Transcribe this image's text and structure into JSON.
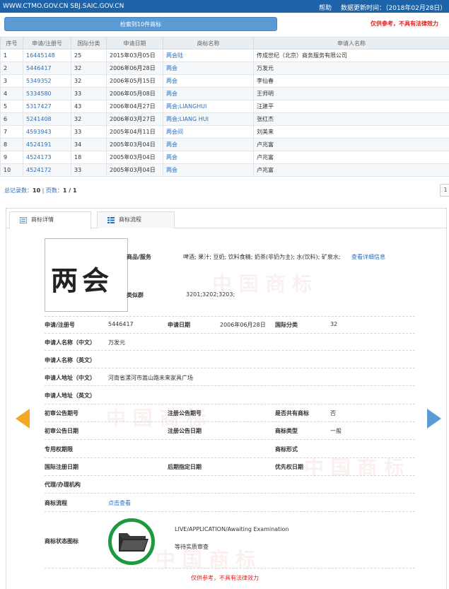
{
  "topbar": {
    "site": "WWW.CTMO.GOV.CN SBJ.SAIC.GOV.CN",
    "help": "帮助",
    "updated": "数据更新时间：（2018年02月28日）"
  },
  "search_result_label": "检索到10件商标",
  "disclaimer_top": "仅供参考，不具有法律效力",
  "table": {
    "headers": [
      "序号",
      "申请/注册号",
      "国际分类",
      "申请日期",
      "商标名称",
      "申请人名称"
    ],
    "rows": [
      [
        "1",
        "16445148",
        "25",
        "2015年03月05日",
        "两会陆",
        "传成世纪（北京）商务服务有限公司"
      ],
      [
        "2",
        "5446417",
        "32",
        "2006年06月28日",
        "两会",
        "万发元"
      ],
      [
        "3",
        "5349352",
        "32",
        "2006年05月15日",
        "两会",
        "李仙春"
      ],
      [
        "4",
        "5334580",
        "33",
        "2006年05月08日",
        "两会",
        "王师明"
      ],
      [
        "5",
        "5317427",
        "43",
        "2006年04月27日",
        "两会;LIANGHUI",
        "汪建平"
      ],
      [
        "6",
        "5241408",
        "32",
        "2006年03月27日",
        "两会;LIANG HUI",
        "张红杰"
      ],
      [
        "7",
        "4593943",
        "33",
        "2005年04月11日",
        "两会间",
        "刘美来"
      ],
      [
        "8",
        "4524191",
        "34",
        "2005年03月04日",
        "两会",
        "卢兆富"
      ],
      [
        "9",
        "4524173",
        "18",
        "2005年03月04日",
        "两会",
        "卢兆富"
      ],
      [
        "10",
        "4524172",
        "33",
        "2005年03月04日",
        "两会",
        "卢兆富"
      ]
    ]
  },
  "pager": {
    "total_label": "总记录数：",
    "total": "10",
    "sep": " | ",
    "pages_label": "页数：",
    "pages": "1 / 1",
    "page_button": "1"
  },
  "tabs": [
    {
      "label": "商标详情",
      "icon": "list-icon"
    },
    {
      "label": "商标流程",
      "icon": "flow-icon"
    }
  ],
  "detail": {
    "logo_text": "两会",
    "goods_label": "商品/服务",
    "goods_value": "啤酒; 果汁; 豆奶; 饮料食精; 奶茶(非奶为主); 水(饮料); 矿泉水;",
    "goods_link": "查看详细信息",
    "similar_label": "类似群",
    "similar_value": "3201;3202;3203;",
    "reg_no_label": "申请/注册号",
    "reg_no_value": "5446417",
    "apply_date_label": "申请日期",
    "apply_date_value": "2006年06月28日",
    "intl_class_label": "国际分类",
    "intl_class_value": "32",
    "applicant_cn_label": "申请人名称（中文）",
    "applicant_cn_value": "万发元",
    "applicant_en_label": "申请人名称（英文）",
    "address_cn_label": "申请人地址（中文）",
    "address_cn_value": "河南省漯河市嵩山路未来家具广场",
    "address_en_label": "申请人地址（英文）",
    "prelim_no_label": "初审公告期号",
    "reg_pub_no_label": "注册公告期号",
    "shared_label": "是否共有商标",
    "shared_value": "否",
    "prelim_date_label": "初审公告日期",
    "reg_pub_date_label": "注册公告日期",
    "tm_type_label": "商标类型",
    "tm_type_value": "一般",
    "exclusive_label": "专用权期限",
    "tm_form_label": "商标形式",
    "intl_reg_date_label": "国际注册日期",
    "later_date_label": "后期指定日期",
    "priority_date_label": "优先权日期",
    "agency_label": "代理/办理机构",
    "process_label": "商标流程",
    "process_link": "点击查看",
    "status_icon_label": "商标状态图标",
    "status_en": "LIVE/APPLICATION/Awaiting Examination",
    "status_cn": "等待实质审查"
  },
  "disclaimer_bottom": "仅供参考，不具有法律效力",
  "colors": {
    "topbar": "#1d63a9",
    "link": "#2a6ebb",
    "warning": "#e02020",
    "status_ring": "#1e9a3e",
    "prev_arrow": "#f5a623",
    "next_arrow": "#5b9bd5"
  }
}
